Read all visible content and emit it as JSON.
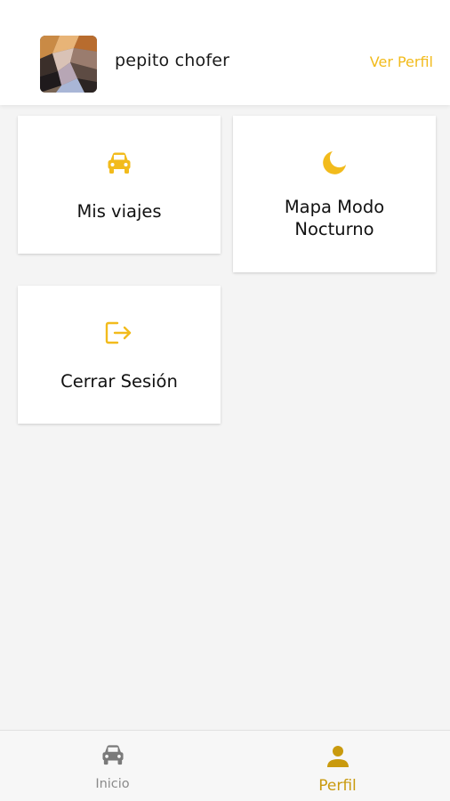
{
  "header": {
    "user_name": "pepito chofer",
    "view_profile_label": "Ver Perfil"
  },
  "cards": {
    "trips": {
      "label": "Mis viajes",
      "icon": "car-icon"
    },
    "night_map": {
      "label_line1": "Mapa Modo",
      "label_line2": "Nocturno",
      "icon": "moon-icon"
    },
    "logout": {
      "label": "Cerrar Sesión",
      "icon": "logout-icon"
    }
  },
  "bottom_nav": {
    "items": [
      {
        "label": "Inicio",
        "icon": "car-icon",
        "active": false
      },
      {
        "label": "Perfil",
        "icon": "person-icon",
        "active": true
      }
    ]
  },
  "colors": {
    "accent": "#f2bb1c",
    "active_nav": "#c99a0e",
    "inactive_nav": "#8a8a8a",
    "background": "#f4f4f4"
  }
}
